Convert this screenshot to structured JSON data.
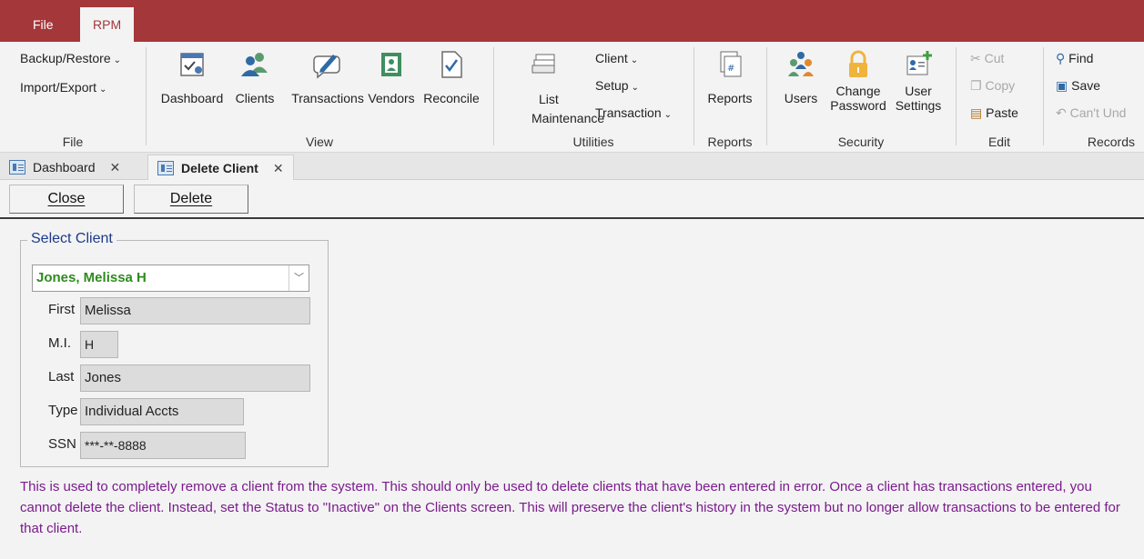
{
  "tabs": {
    "file": "File",
    "rpm": "RPM"
  },
  "ribbon": {
    "file_group": {
      "backup": "Backup/Restore",
      "import": "Import/Export",
      "label": "File"
    },
    "view_group": {
      "label": "View",
      "buttons": [
        "Dashboard",
        "Clients",
        "Transactions",
        "Vendors",
        "Reconcile"
      ]
    },
    "utilities_group": {
      "label": "Utilities",
      "list_line1": "List",
      "list_line2": "Maintenance",
      "client": "Client",
      "setup": "Setup",
      "transaction": "Transaction"
    },
    "reports_group": {
      "label": "Reports",
      "reports": "Reports"
    },
    "security_group": {
      "label": "Security",
      "users": "Users",
      "change_line1": "Change",
      "change_line2": "Password",
      "user_line1": "User",
      "user_line2": "Settings"
    },
    "edit_group": {
      "label": "Edit",
      "cut": "Cut",
      "copy": "Copy",
      "paste": "Paste"
    },
    "records_group": {
      "label": "Records",
      "find": "Find",
      "save": "Save",
      "cant_undo": "Can't Und"
    }
  },
  "doc_tabs": [
    {
      "label": "Dashboard"
    },
    {
      "label": "Delete Client"
    }
  ],
  "commands": {
    "close": "Close",
    "delete": "Delete"
  },
  "form": {
    "legend": "Select Client",
    "selected_client": "Jones, Melissa H",
    "fields": {
      "first_label": "First",
      "first_value": "Melissa",
      "mi_label": "M.I.",
      "mi_value": "H",
      "last_label": "Last",
      "last_value": "Jones",
      "type_label": "Type",
      "type_value": "Individual Accts",
      "ssn_label": "SSN",
      "ssn_value": "***-**-8888"
    }
  },
  "note": "This is used to completely remove a client from the system. This should only be used to delete clients that have been entered in error. Once a client has transactions entered, you cannot delete the client. Instead, set the Status to \"Inactive\" on the Clients screen. This will preserve the client's history in the system but no longer allow transactions to be entered for that client.",
  "colors": {
    "accent": "#a4373a",
    "legend": "#1e3a8a",
    "combo_text": "#2e8b1e",
    "note": "#7a1b8c"
  }
}
